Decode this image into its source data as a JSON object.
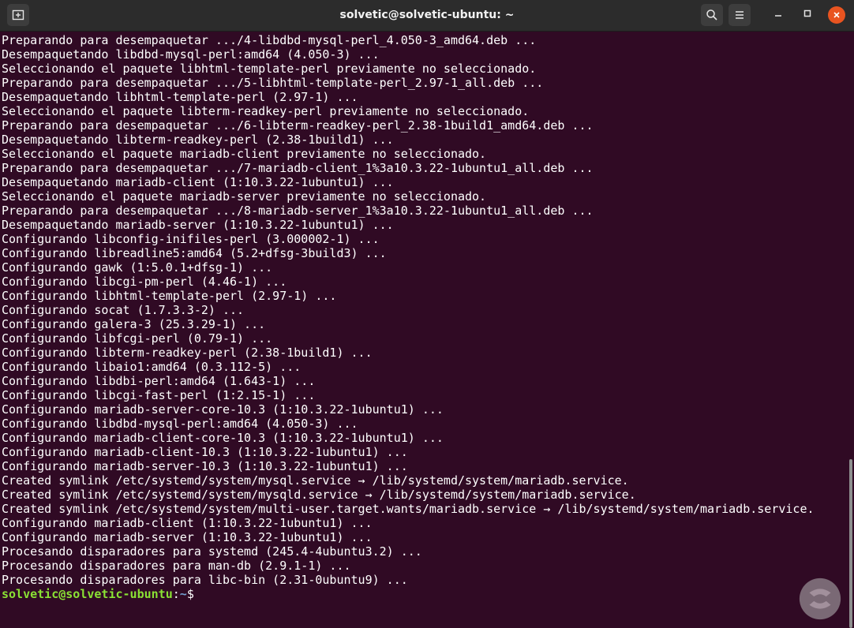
{
  "window": {
    "title": "solvetic@solvetic-ubuntu: ~",
    "icons": {
      "new_tab": "new-tab-icon",
      "search": "search-icon",
      "menu": "hamburger-menu-icon",
      "minimize": "minimize-icon",
      "maximize": "maximize-icon",
      "close": "close-icon"
    }
  },
  "colors": {
    "terminal_bg": "#300a24",
    "titlebar_bg": "#2c2c2c",
    "prompt_user": "#8ae234",
    "prompt_path": "#729fcf",
    "close_button": "#e95420"
  },
  "terminal": {
    "lines": [
      "Preparando para desempaquetar .../4-libdbd-mysql-perl_4.050-3_amd64.deb ...",
      "Desempaquetando libdbd-mysql-perl:amd64 (4.050-3) ...",
      "Seleccionando el paquete libhtml-template-perl previamente no seleccionado.",
      "Preparando para desempaquetar .../5-libhtml-template-perl_2.97-1_all.deb ...",
      "Desempaquetando libhtml-template-perl (2.97-1) ...",
      "Seleccionando el paquete libterm-readkey-perl previamente no seleccionado.",
      "Preparando para desempaquetar .../6-libterm-readkey-perl_2.38-1build1_amd64.deb ...",
      "Desempaquetando libterm-readkey-perl (2.38-1build1) ...",
      "Seleccionando el paquete mariadb-client previamente no seleccionado.",
      "Preparando para desempaquetar .../7-mariadb-client_1%3a10.3.22-1ubuntu1_all.deb ...",
      "Desempaquetando mariadb-client (1:10.3.22-1ubuntu1) ...",
      "Seleccionando el paquete mariadb-server previamente no seleccionado.",
      "Preparando para desempaquetar .../8-mariadb-server_1%3a10.3.22-1ubuntu1_all.deb ...",
      "Desempaquetando mariadb-server (1:10.3.22-1ubuntu1) ...",
      "Configurando libconfig-inifiles-perl (3.000002-1) ...",
      "Configurando libreadline5:amd64 (5.2+dfsg-3build3) ...",
      "Configurando gawk (1:5.0.1+dfsg-1) ...",
      "Configurando libcgi-pm-perl (4.46-1) ...",
      "Configurando libhtml-template-perl (2.97-1) ...",
      "Configurando socat (1.7.3.3-2) ...",
      "Configurando galera-3 (25.3.29-1) ...",
      "Configurando libfcgi-perl (0.79-1) ...",
      "Configurando libterm-readkey-perl (2.38-1build1) ...",
      "Configurando libaio1:amd64 (0.3.112-5) ...",
      "Configurando libdbi-perl:amd64 (1.643-1) ...",
      "Configurando libcgi-fast-perl (1:2.15-1) ...",
      "Configurando mariadb-server-core-10.3 (1:10.3.22-1ubuntu1) ...",
      "Configurando libdbd-mysql-perl:amd64 (4.050-3) ...",
      "Configurando mariadb-client-core-10.3 (1:10.3.22-1ubuntu1) ...",
      "Configurando mariadb-client-10.3 (1:10.3.22-1ubuntu1) ...",
      "Configurando mariadb-server-10.3 (1:10.3.22-1ubuntu1) ...",
      "Created symlink /etc/systemd/system/mysql.service → /lib/systemd/system/mariadb.service.",
      "Created symlink /etc/systemd/system/mysqld.service → /lib/systemd/system/mariadb.service.",
      "Created symlink /etc/systemd/system/multi-user.target.wants/mariadb.service → /lib/systemd/system/mariadb.service.",
      "Configurando mariadb-client (1:10.3.22-1ubuntu1) ...",
      "Configurando mariadb-server (1:10.3.22-1ubuntu1) ...",
      "Procesando disparadores para systemd (245.4-4ubuntu3.2) ...",
      "Procesando disparadores para man-db (2.9.1-1) ...",
      "Procesando disparadores para libc-bin (2.31-0ubuntu9) ..."
    ],
    "prompt": {
      "user_host": "solvetic@solvetic-ubuntu",
      "separator": ":",
      "path": "~",
      "symbol": "$"
    }
  }
}
